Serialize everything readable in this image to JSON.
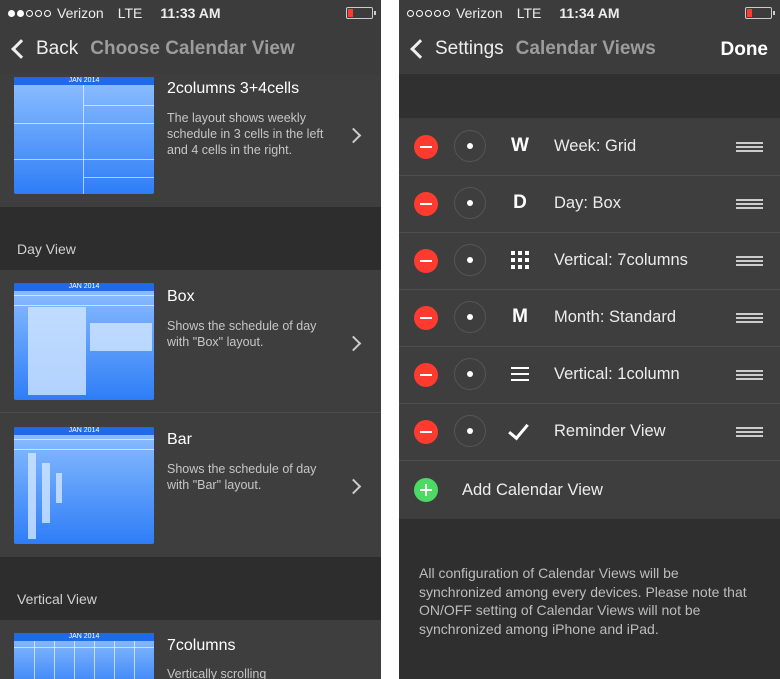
{
  "left": {
    "status": {
      "carrier": "Verizon",
      "network": "LTE",
      "time": "11:33 AM"
    },
    "nav": {
      "back_label": "Back",
      "title": "Choose Calendar View"
    },
    "cells": [
      {
        "thumb": "JAN 2014",
        "title": "2columns 3+4cells",
        "desc": "The layout shows weekly schedule in 3 cells in the left and 4 cells in the right."
      },
      {
        "thumb": "JAN 2014",
        "title": "Box",
        "desc": "Shows the schedule of day with \"Box\" layout."
      },
      {
        "thumb": "JAN 2014",
        "title": "Bar",
        "desc": "Shows the schedule of day with \"Bar\" layout."
      },
      {
        "thumb": "JAN 2014",
        "title": "7columns",
        "desc": "Vertically scrolling"
      }
    ],
    "sections": {
      "day": "Day View",
      "vertical": "Vertical View"
    }
  },
  "right": {
    "status": {
      "carrier": "Verizon",
      "network": "LTE",
      "time": "11:34 AM"
    },
    "nav": {
      "back_label": "Settings",
      "title": "Calendar Views",
      "done_label": "Done"
    },
    "rows": [
      {
        "glyph": "W",
        "icon": "letter-w",
        "label": "Week: Grid"
      },
      {
        "glyph": "D",
        "icon": "letter-d",
        "label": "Day: Box"
      },
      {
        "glyph": "",
        "icon": "grid-icon",
        "label": "Vertical: 7columns"
      },
      {
        "glyph": "M",
        "icon": "letter-m",
        "label": "Month: Standard"
      },
      {
        "glyph": "",
        "icon": "list-icon",
        "label": "Vertical: 1column"
      },
      {
        "glyph": "",
        "icon": "checkmark-icon",
        "label": "Reminder View"
      }
    ],
    "add_label": "Add Calendar View",
    "note": "All configuration of Calendar Views will be synchronized among every devices. Please note that ON/OFF setting of Calendar Views will not be synchronized among iPhone and iPad."
  },
  "colors": {
    "delete": "#ff3b30",
    "add": "#4cd964",
    "thumb_blue": "#2e7df7",
    "battery": "#ff3b30"
  }
}
